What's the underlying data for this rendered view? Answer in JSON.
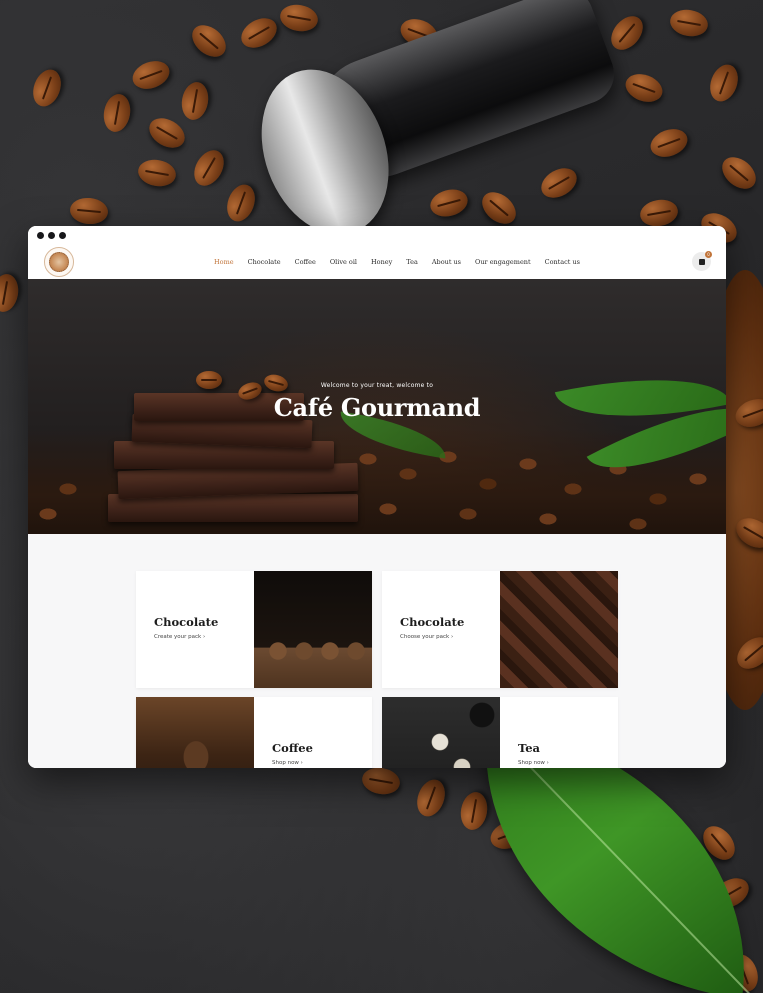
{
  "site": {
    "nav": [
      {
        "label": "Home",
        "active": true
      },
      {
        "label": "Chocolate"
      },
      {
        "label": "Coffee"
      },
      {
        "label": "Olive oil"
      },
      {
        "label": "Honey"
      },
      {
        "label": "Tea"
      },
      {
        "label": "About us"
      },
      {
        "label": "Our engagement"
      },
      {
        "label": "Contact us"
      }
    ],
    "cart_count": "0",
    "accent_color": "#c1743a"
  },
  "hero": {
    "kicker": "Welcome to your treat, welcome to",
    "title": "Café Gourmand"
  },
  "cards": [
    {
      "title": "Chocolate",
      "link": "Create your pack ›"
    },
    {
      "title": "Chocolate",
      "link": "Choose your pack ›"
    },
    {
      "title": "Coffee",
      "link": "Shop now ›"
    },
    {
      "title": "Tea",
      "link": "Shop now ›"
    }
  ]
}
